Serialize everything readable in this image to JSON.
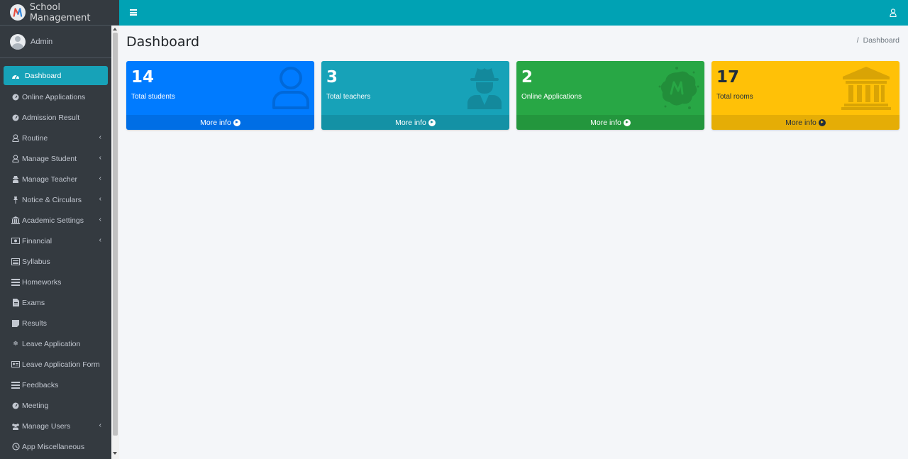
{
  "brand": {
    "name": "School Management"
  },
  "user": {
    "name": "Admin"
  },
  "sidebar": {
    "items": [
      {
        "label": "Dashboard",
        "icon": "tachometer-icon",
        "active": true,
        "has_submenu": false
      },
      {
        "label": "Online Applications",
        "icon": "dashboard-gauge-icon",
        "has_submenu": false
      },
      {
        "label": "Admission Result",
        "icon": "dashboard-gauge-icon",
        "has_submenu": false
      },
      {
        "label": "Routine",
        "icon": "user-outline-icon",
        "has_submenu": true
      },
      {
        "label": "Manage Student",
        "icon": "user-outline-icon",
        "has_submenu": true
      },
      {
        "label": "Manage Teacher",
        "icon": "user-secret-icon",
        "has_submenu": true
      },
      {
        "label": "Notice & Circulars",
        "icon": "thumbtack-icon",
        "has_submenu": true
      },
      {
        "label": "Academic Settings",
        "icon": "university-icon",
        "has_submenu": true
      },
      {
        "label": "Financial",
        "icon": "money-bill-icon",
        "has_submenu": true
      },
      {
        "label": "Syllabus",
        "icon": "list-alt-icon",
        "has_submenu": false
      },
      {
        "label": "Homeworks",
        "icon": "list-icon",
        "has_submenu": false
      },
      {
        "label": "Exams",
        "icon": "file-text-icon",
        "has_submenu": false
      },
      {
        "label": "Results",
        "icon": "sticky-note-icon",
        "has_submenu": false
      },
      {
        "label": "Leave Application",
        "icon": "snowflake-icon",
        "has_submenu": false
      },
      {
        "label": "Leave Application Form",
        "icon": "id-card-icon",
        "has_submenu": false
      },
      {
        "label": "Feedbacks",
        "icon": "list-icon",
        "has_submenu": false
      },
      {
        "label": "Meeting",
        "icon": "dashboard-gauge-icon",
        "has_submenu": false
      },
      {
        "label": "Manage Users",
        "icon": "users-icon",
        "has_submenu": true
      },
      {
        "label": "App Miscellaneous",
        "icon": "history-icon",
        "has_submenu": false
      }
    ]
  },
  "header": {
    "toggle_icon": "bars-icon",
    "user_icon": "user-outline-icon"
  },
  "page": {
    "title": "Dashboard",
    "breadcrumb_sep": "/",
    "breadcrumb": "Dashboard"
  },
  "boxes": [
    {
      "value": "14",
      "label": "Total students",
      "footer": "More info",
      "color": "#007bff",
      "icon": "user-outline-icon"
    },
    {
      "value": "3",
      "label": "Total teachers",
      "footer": "More info",
      "color": "#17a2b8",
      "icon": "user-secret-icon"
    },
    {
      "value": "2",
      "label": "Online Applications",
      "footer": "More info",
      "color": "#28a745",
      "icon": "meetup-icon"
    },
    {
      "value": "17",
      "label": "Total rooms",
      "footer": "More info",
      "color": "#ffc107",
      "icon": "university-icon"
    }
  ],
  "colors": {
    "sidebar_bg": "#343a40",
    "navbar_bg": "#00a2b4",
    "active_item": "#17a2b8",
    "content_bg": "#f4f6f9"
  }
}
